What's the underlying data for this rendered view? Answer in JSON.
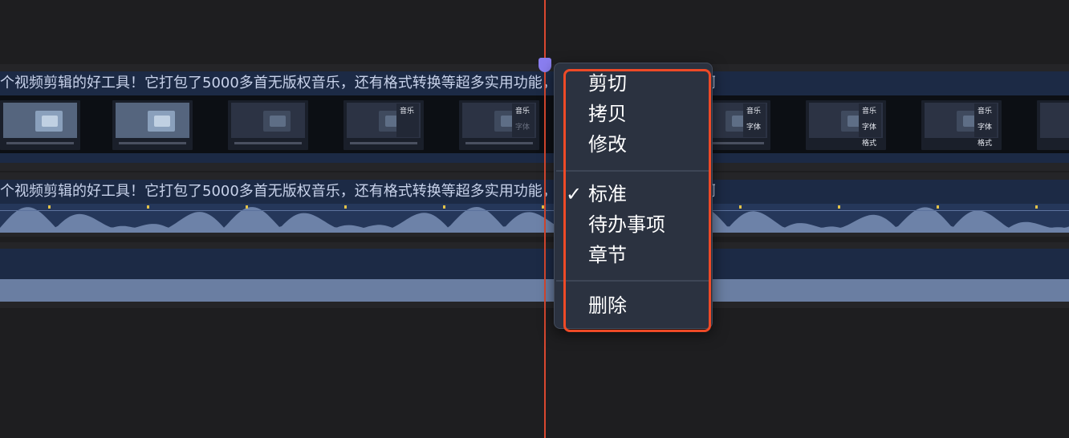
{
  "clip": {
    "title": "个视频剪辑的好工具！它打包了5000多首无版权音乐，还有格式转换等超多实用功能，干货满满，一定要收藏啊"
  },
  "thumbnails": {
    "music_label": "音乐",
    "font_label": "字体",
    "format_label": "格式"
  },
  "context_menu": {
    "items": [
      {
        "label": "剪切"
      },
      {
        "label": "拷贝"
      },
      {
        "label": "修改"
      },
      {
        "label": "标准",
        "checked": true
      },
      {
        "label": "待办事项"
      },
      {
        "label": "章节"
      },
      {
        "label": "删除"
      }
    ],
    "check_mark": "✓"
  },
  "colors": {
    "playhead": "#d9482f",
    "playhead_knob": "#8a7ef0",
    "highlight": "#ee4a27",
    "track": "#1c2a45"
  }
}
